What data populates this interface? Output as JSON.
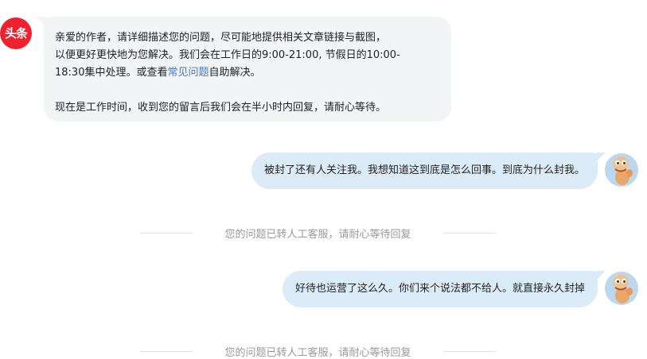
{
  "support": {
    "avatar_text": "头条",
    "line1": "亲爱的作者，请详细描述您的问题，尽可能地提供相关文章链接与截图，",
    "line2": "以便更好更快地为您解决。我们会在工作日的9:00-21:00, 节假日的10:00-",
    "line3_before": "18:30集中处理。或查看",
    "faq_link": "常见问题",
    "line3_after": "自助解决。",
    "line4": "现在是工作时间，收到您的留言后我们会在半小时内回复，请耐心等待。"
  },
  "messages": [
    {
      "text": "被封了还有人关注我。我想知道这到底是怎么回事。到底为什么封我。"
    },
    {
      "text": "好待也运营了这么久。你们来个说法都不给人。就直接永久封掉"
    }
  ],
  "system_notices": [
    {
      "text": "您的问题已转人工客服，请耐心等待回复"
    },
    {
      "text": "您的问题已转人工客服，请耐心等待回复"
    }
  ],
  "colors": {
    "support_bubble": "#f3f4f6",
    "user_bubble": "#dcebf8",
    "brand_red": "#f0212f",
    "link": "#4a78c0",
    "notice_text": "#9a9a9a"
  },
  "icons": {
    "support_avatar": "toutiao-logo",
    "user_avatar": "cartoon-avatar"
  }
}
